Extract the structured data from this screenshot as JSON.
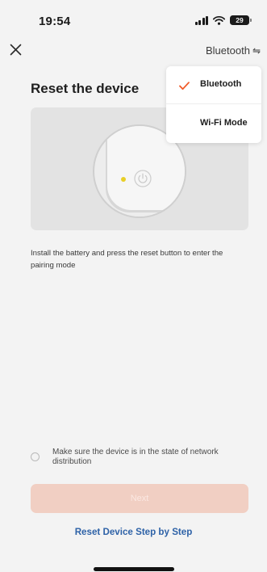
{
  "status_bar": {
    "time": "19:54",
    "battery": "29",
    "icons": [
      "signal-icon",
      "wifi-icon",
      "battery-icon"
    ]
  },
  "nav": {
    "close_icon": "close-icon",
    "mode_label": "Bluetooth",
    "mode_icon": "swap-arrows-icon"
  },
  "page_title": "Reset the device",
  "illustration": {
    "icons": [
      "device-icon",
      "led-dot",
      "power-icon"
    ],
    "led_color": "#e8cf27"
  },
  "instruction": "Install the battery and press the reset button to enter the pairing mode",
  "confirm": {
    "label": "Make sure the device is in the state of network distribution",
    "checked": false
  },
  "next_button": {
    "label": "Next",
    "enabled": false
  },
  "reset_link": "Reset Device Step by Step",
  "dropdown": {
    "items": [
      {
        "label": "Bluetooth",
        "selected": true
      },
      {
        "label": "Wi-Fi Mode",
        "selected": false
      }
    ],
    "accent_color": "#f05a28"
  },
  "colors": {
    "link": "#2e62a7",
    "button_disabled": "#f1cfc3"
  }
}
